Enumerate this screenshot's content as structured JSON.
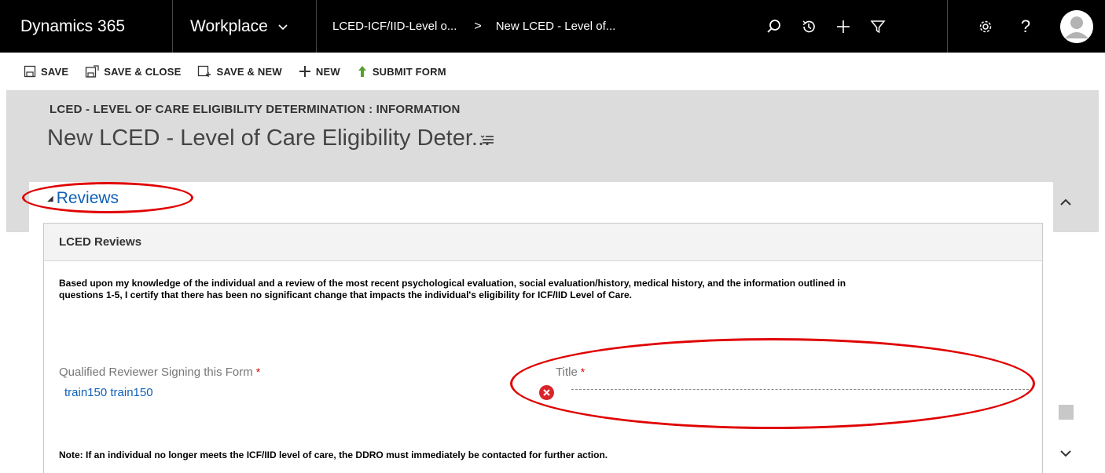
{
  "topnav": {
    "brand": "Dynamics 365",
    "app": "Workplace",
    "breadcrumb": [
      "LCED-ICF/IID-Level o...",
      "New LCED - Level of..."
    ],
    "breadcrumb_sep": ">",
    "help": "?"
  },
  "commands": {
    "save": "SAVE",
    "save_close": "SAVE & CLOSE",
    "save_new": "SAVE & NEW",
    "new": "NEW",
    "submit": "SUBMIT FORM"
  },
  "header": {
    "entity": "LCED - LEVEL OF CARE ELIGIBILITY DETERMINATION : INFORMATION",
    "record_title": "New LCED - Level of Care Eligibility Deter..."
  },
  "form": {
    "tab": "Reviews",
    "section_title": "LCED Reviews",
    "certification_line1": "Based upon my knowledge of the individual and a review of the most recent psychological evaluation, social evaluation/history, medical history, and the information outlined in",
    "certification_line2": "questions 1-5, I certify that there has been no significant change that impacts the individual's eligibility for ICF/IID Level of Care.",
    "reviewer_label": "Qualified Reviewer Signing this Form",
    "reviewer_value": "train150 train150",
    "title_label": "Title",
    "required_mark": "*",
    "note": "Note: If an individual no longer meets the ICF/IID level of care, the DDRO must immediately be contacted for further action."
  },
  "colors": {
    "nav_bg": "#000000",
    "link_blue": "#1160b7",
    "annotation_red": "#e00000",
    "error_red": "#d8252a",
    "header_grey": "#dcdcdc"
  }
}
